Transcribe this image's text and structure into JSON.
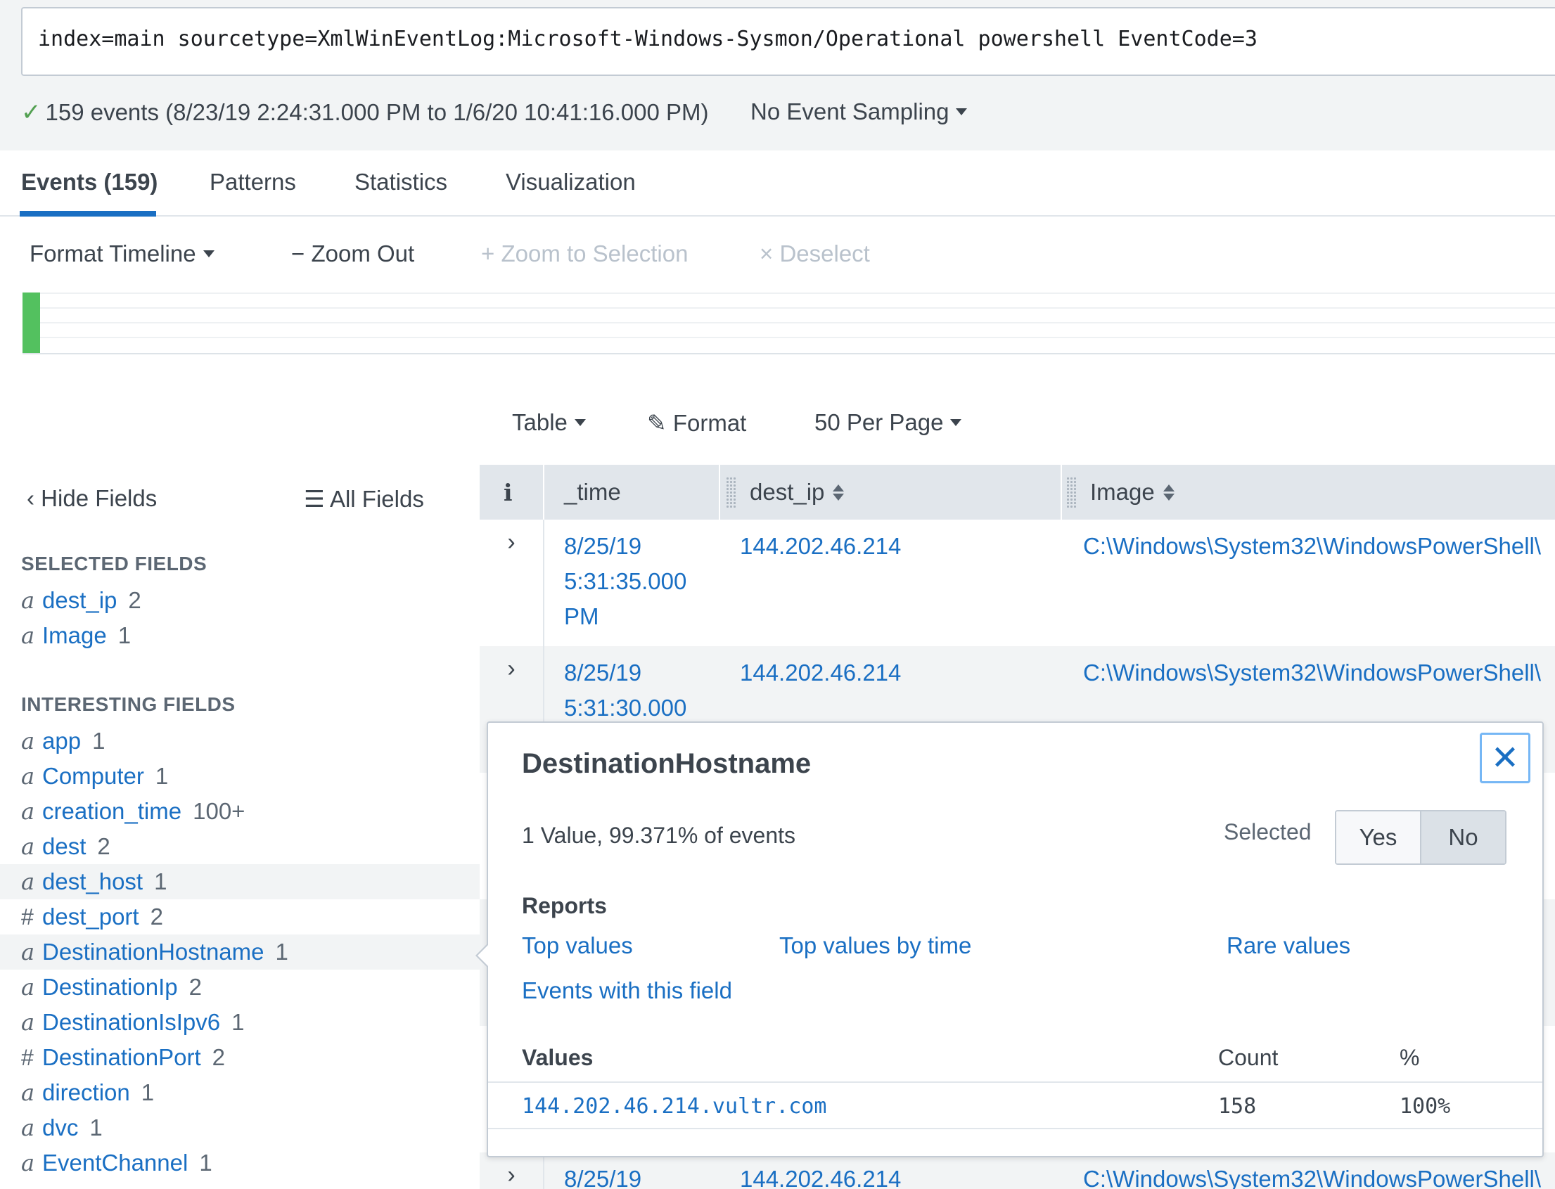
{
  "search": {
    "query": "index=main sourcetype=XmlWinEventLog:Microsoft-Windows-Sysmon/Operational powershell EventCode=3"
  },
  "status": {
    "events_summary": "159 events (8/23/19 2:24:31.000 PM to 1/6/20 10:41:16.000 PM)",
    "sampling": "No Event Sampling",
    "accent_color": "#53a051"
  },
  "tabs": [
    {
      "label": "Events (159)",
      "active": true
    },
    {
      "label": "Patterns",
      "active": false
    },
    {
      "label": "Statistics",
      "active": false
    },
    {
      "label": "Visualization",
      "active": false
    }
  ],
  "timeline_toolbar": {
    "format_timeline": "Format Timeline",
    "zoom_out": "Zoom Out",
    "zoom_to_selection": "Zoom to Selection",
    "deselect": "Deselect"
  },
  "table_toolbar": {
    "table": "Table",
    "format": "Format",
    "per_page": "50 Per Page"
  },
  "sidebar": {
    "hide_fields": "Hide Fields",
    "all_fields": "All Fields",
    "selected_title": "SELECTED FIELDS",
    "selected_fields": [
      {
        "type": "a",
        "name": "dest_ip",
        "count": "2"
      },
      {
        "type": "a",
        "name": "Image",
        "count": "1"
      }
    ],
    "interesting_title": "INTERESTING FIELDS",
    "interesting_fields": [
      {
        "type": "a",
        "name": "app",
        "count": "1"
      },
      {
        "type": "a",
        "name": "Computer",
        "count": "1"
      },
      {
        "type": "a",
        "name": "creation_time",
        "count": "100+"
      },
      {
        "type": "a",
        "name": "dest",
        "count": "2"
      },
      {
        "type": "a",
        "name": "dest_host",
        "count": "1"
      },
      {
        "type": "#",
        "name": "dest_port",
        "count": "2"
      },
      {
        "type": "a",
        "name": "DestinationHostname",
        "count": "1"
      },
      {
        "type": "a",
        "name": "DestinationIp",
        "count": "2"
      },
      {
        "type": "a",
        "name": "DestinationIsIpv6",
        "count": "1"
      },
      {
        "type": "#",
        "name": "DestinationPort",
        "count": "2"
      },
      {
        "type": "a",
        "name": "direction",
        "count": "1"
      },
      {
        "type": "a",
        "name": "dvc",
        "count": "1"
      },
      {
        "type": "a",
        "name": "EventChannel",
        "count": "1"
      }
    ]
  },
  "table": {
    "info_header": "i",
    "columns": [
      "_time",
      "dest_ip",
      "Image"
    ],
    "rows": [
      {
        "time": "8/25/19 5:31:35.000 PM",
        "dest_ip": "144.202.46.214",
        "image": "C:\\Windows\\System32\\WindowsPowerShell\\"
      },
      {
        "time": "8/25/19 5:31:30.000",
        "dest_ip": "144.202.46.214",
        "image": "C:\\Windows\\System32\\WindowsPowerShell\\"
      },
      {
        "time": "8/25/19",
        "dest_ip": "144.202.46.214",
        "image": "C:\\Windows\\System32\\WindowsPowerShell\\"
      }
    ]
  },
  "popover": {
    "title": "DestinationHostname",
    "summary": "1 Value, 99.371% of events",
    "selected_label": "Selected",
    "yes": "Yes",
    "no": "No",
    "reports_title": "Reports",
    "reports": {
      "top_values": "Top values",
      "top_values_by_time": "Top values by time",
      "rare_values": "Rare values",
      "events_with_field": "Events with this field"
    },
    "values_header": "Values",
    "count_header": "Count",
    "pct_header": "%",
    "values": [
      {
        "value": "144.202.46.214.vultr.com",
        "count": "158",
        "pct": "100%"
      }
    ]
  }
}
